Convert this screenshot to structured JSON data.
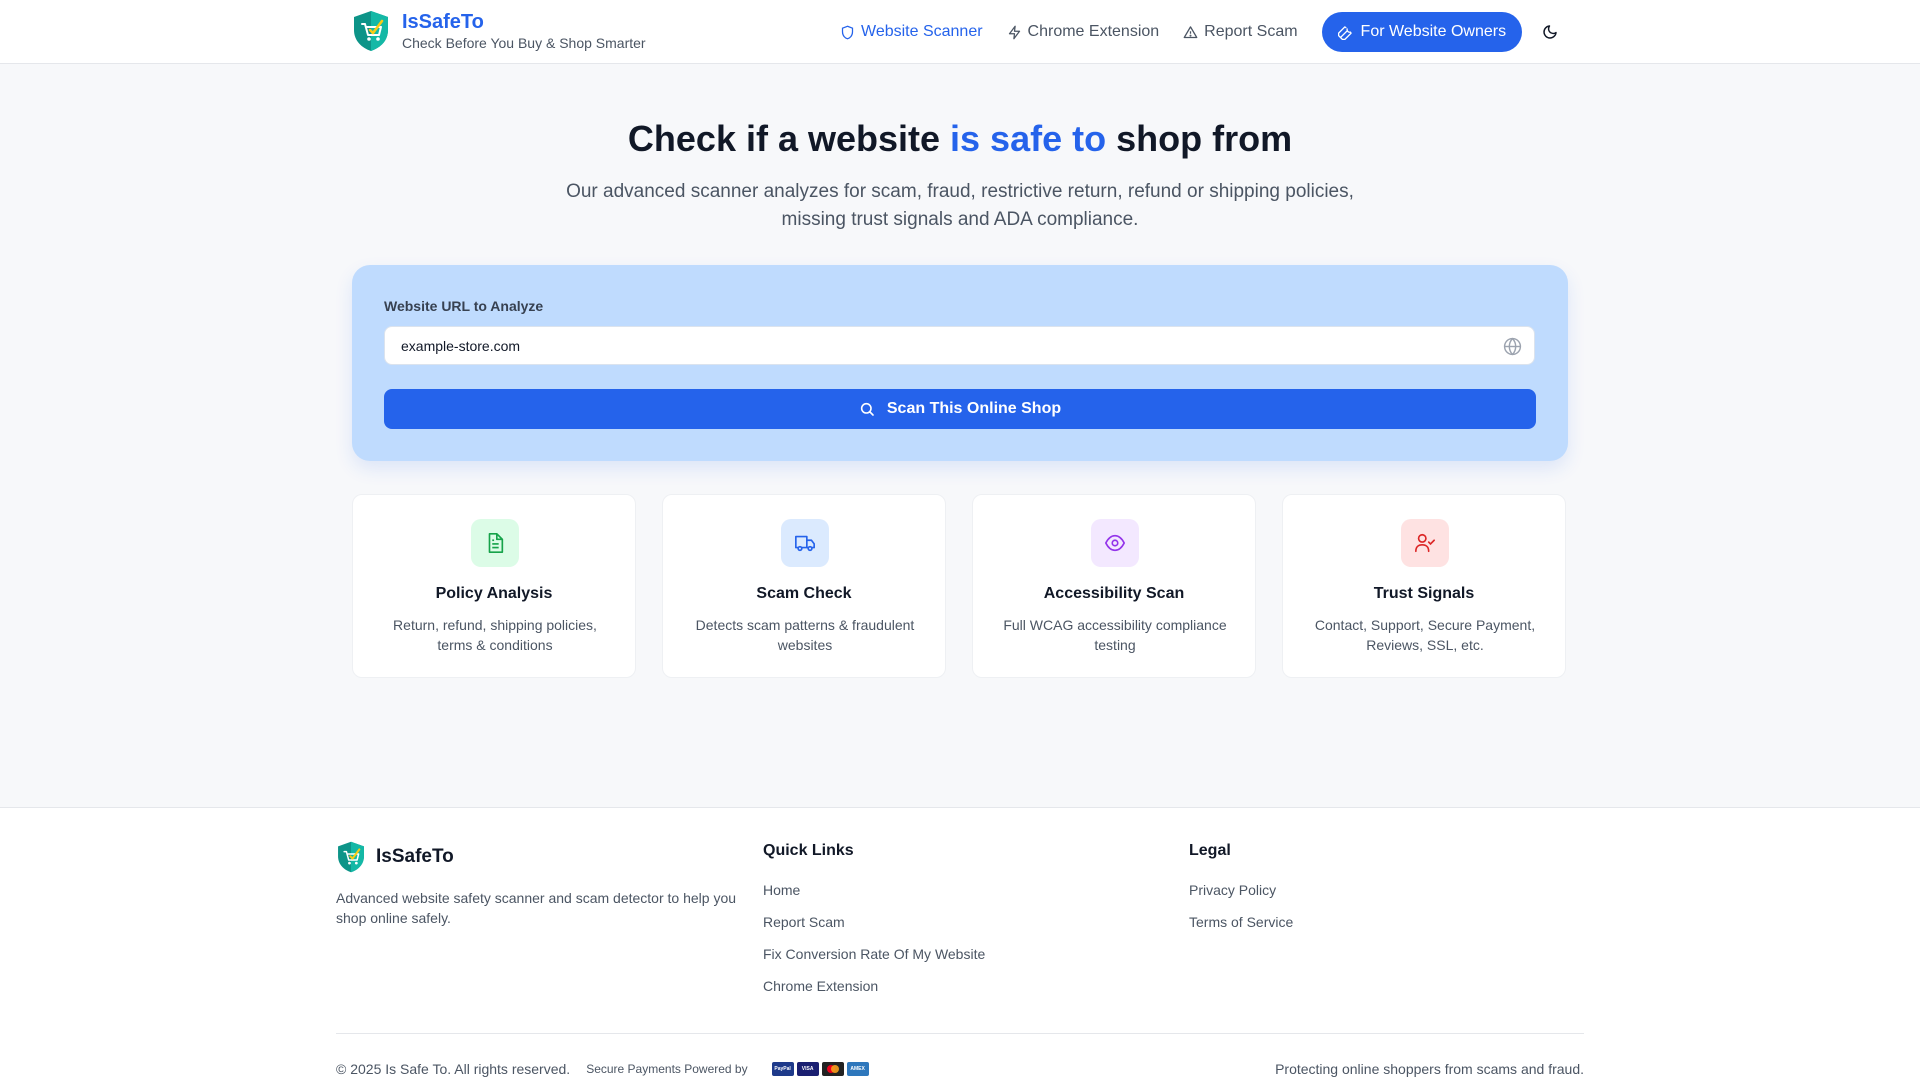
{
  "brand": {
    "name": "IsSafeTo",
    "tagline": "Check Before You Buy & Shop Smarter"
  },
  "nav": {
    "items": [
      {
        "label": "Website Scanner",
        "icon": "shield-icon",
        "active": true
      },
      {
        "label": "Chrome Extension",
        "icon": "zap-icon",
        "active": false
      },
      {
        "label": "Report Scam",
        "icon": "warning-icon",
        "active": false
      }
    ],
    "cta_label": "For Website Owners",
    "cta_icon": "wrench-icon",
    "theme_icon": "moon-icon"
  },
  "hero": {
    "title_pre": "Check if a website ",
    "title_accent": "is safe to",
    "title_post": " shop from",
    "subtitle": "Our advanced scanner analyzes for scam, fraud, restrictive return, refund or shipping policies, missing trust signals and ADA compliance."
  },
  "scanner": {
    "label": "Website URL to Analyze",
    "input_value": "example-store.com",
    "button_label": "Scan This Online Shop"
  },
  "features": [
    {
      "title": "Policy Analysis",
      "desc": "Return, refund, shipping policies, terms & conditions",
      "icon": "document-icon",
      "bg": "#dcfce7",
      "fg": "#16a34a"
    },
    {
      "title": "Scam Check",
      "desc": "Detects scam patterns & fraudulent websites",
      "icon": "truck-icon",
      "bg": "#dbeafe",
      "fg": "#2563eb"
    },
    {
      "title": "Accessibility Scan",
      "desc": "Full WCAG accessibility compliance testing",
      "icon": "eye-icon",
      "bg": "#f3e8ff",
      "fg": "#9333ea"
    },
    {
      "title": "Trust Signals",
      "desc": "Contact, Support, Secure Payment, Reviews, SSL, etc.",
      "icon": "user-check-icon",
      "bg": "#fee2e2",
      "fg": "#dc2626"
    }
  ],
  "footer": {
    "brand_name": "IsSafeTo",
    "description": "Advanced website safety scanner and scam detector to help you shop online safely.",
    "quick_links_title": "Quick Links",
    "quick_links": [
      "Home",
      "Report Scam",
      "Fix Conversion Rate Of My Website",
      "Chrome Extension"
    ],
    "legal_title": "Legal",
    "legal_links": [
      "Privacy Policy",
      "Terms of Service"
    ],
    "copyright": "© 2025 Is Safe To. All rights reserved.",
    "secure_payments": "Secure Payments Powered by",
    "payment_cards": [
      "PayPal",
      "VISA",
      "Mastercard",
      "AMEX"
    ],
    "tagline": "Protecting online shoppers from scams and fraud."
  },
  "colors": {
    "accent": "#2563eb",
    "scanner_bg": "#bfdbfe",
    "logo_teal": "#14b8a6"
  }
}
